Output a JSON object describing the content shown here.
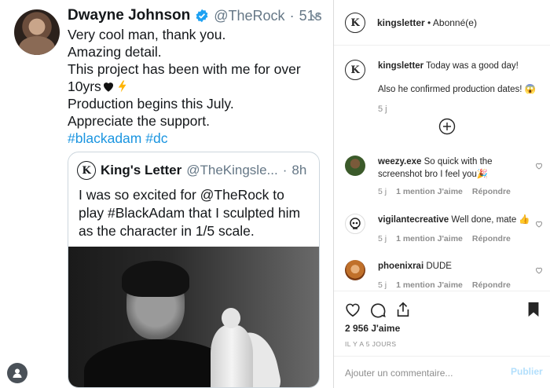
{
  "tweet": {
    "author_name": "Dwayne Johnson",
    "handle": "@TheRock",
    "separator": "·",
    "time": "51s",
    "lines": [
      "Very cool man, thank you.",
      "Amazing detail.",
      "This project has been with me for over",
      "10yrs",
      "Production begins this July.",
      "Appreciate the support."
    ],
    "hashtags": "#blackadam #dc",
    "quoted": {
      "author_name": "King's Letter",
      "handle": "@TheKingsle...",
      "separator": "·",
      "time": "8h",
      "lines": [
        "I was so excited for @TheRock to",
        "play #BlackAdam that I sculpted him",
        "as the character in 1/5 scale."
      ],
      "avatar_letter": "K"
    },
    "link_color": "#1b95e0",
    "verified_color": "#1da1f2"
  },
  "instagram": {
    "header": {
      "username": "kingsletter",
      "separator": " • ",
      "follow_status": "Abonné(e)",
      "logo_letter": "K"
    },
    "caption": {
      "username": "kingsletter",
      "text1": "Today was a good day!",
      "text2": "Also he confirmed production dates! 😱",
      "time": "5 j"
    },
    "comments": [
      {
        "username": "weezy.exe",
        "text": "So quick with the screenshot bro I feel you🎉",
        "time": "5 j",
        "likes": "1 mention J'aime",
        "reply": "Répondre"
      },
      {
        "username": "vigilantecreative",
        "text": "Well done, mate 👍",
        "time": "5 j",
        "likes": "1 mention J'aime",
        "reply": "Répondre"
      },
      {
        "username": "phoenixrai",
        "text": "DUDE",
        "time": "5 j",
        "likes": "1 mention J'aime",
        "reply": "Répondre"
      }
    ],
    "likes_count": "2 956 J'aime",
    "ago": "IL Y A 5 JOURS",
    "comment_placeholder": "Ajouter un commentaire...",
    "publish_label": "Publier",
    "publish_color": "#b2dffc"
  }
}
